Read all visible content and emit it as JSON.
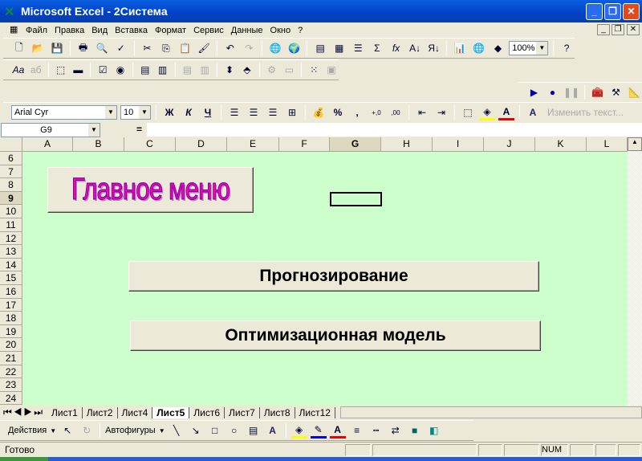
{
  "title": "Microsoft Excel - 2Система",
  "menu": [
    "Файл",
    "Правка",
    "Вид",
    "Вставка",
    "Формат",
    "Сервис",
    "Данные",
    "Окно",
    "?"
  ],
  "zoom": "100%",
  "font": {
    "name": "Arial Cyr",
    "size": "10"
  },
  "format_buttons": {
    "bold": "Ж",
    "italic": "К",
    "underline": "Ч",
    "percent": "%",
    "comma": ","
  },
  "edit_text": "Изменить текст...",
  "name_box": "G9",
  "formula_eq": "=",
  "columns": [
    "A",
    "B",
    "C",
    "D",
    "E",
    "F",
    "G",
    "H",
    "I",
    "J",
    "K",
    "L"
  ],
  "rows": [
    "6",
    "7",
    "8",
    "9",
    "10",
    "11",
    "12",
    "13",
    "14",
    "15",
    "16",
    "17",
    "18",
    "19",
    "20",
    "21",
    "22",
    "23",
    "24"
  ],
  "wordart": "Главное меню",
  "buttons": {
    "forecast": "Прогнозирование",
    "optimization": "Оптимизационная модель"
  },
  "sheets": [
    "Лист1",
    "Лист2",
    "Лист4",
    "Лист5",
    "Лист6",
    "Лист7",
    "Лист8",
    "Лист12"
  ],
  "active_sheet": "Лист5",
  "draw": {
    "actions": "Действия",
    "autoshapes": "Автофигуры"
  },
  "status": {
    "ready": "Готово",
    "num": "NUM"
  },
  "colors": {
    "grid": "#ccffcc",
    "title": "#0a5fe0"
  }
}
